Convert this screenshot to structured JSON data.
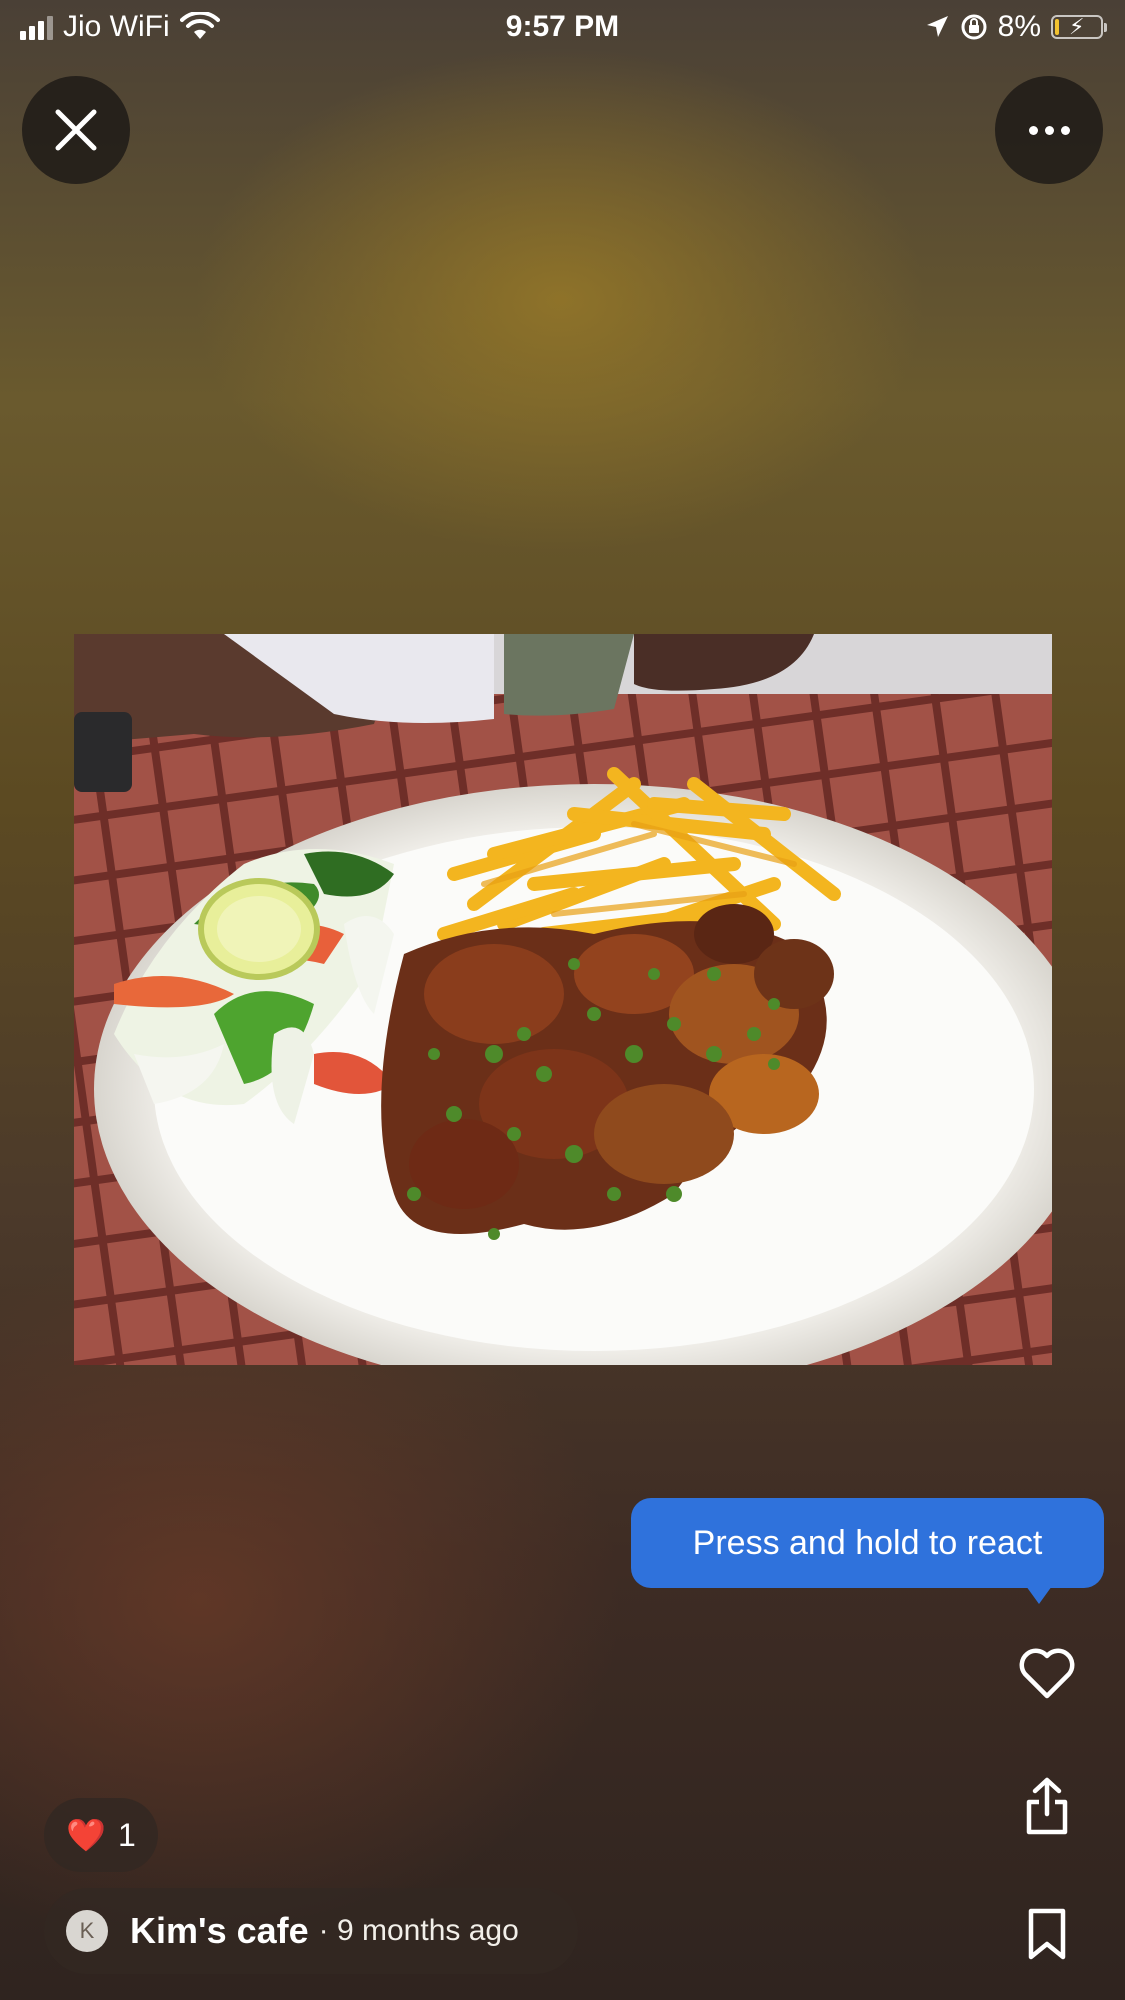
{
  "status_bar": {
    "carrier": "Jio WiFi",
    "time": "9:57 PM",
    "battery_percent": "8%",
    "battery_level": 0.08,
    "icons": [
      "signal-bars-icon",
      "wifi-icon",
      "location-arrow-icon",
      "rotation-lock-icon",
      "battery-charging-icon"
    ]
  },
  "header": {
    "close_icon": "close-icon",
    "more_icon": "more-horizontal-icon"
  },
  "photo": {
    "subject": "plate of grilled chicken, fries, salad and lime"
  },
  "tooltip": {
    "text": "Press and hold to react",
    "color": "#2f72dc"
  },
  "actions": {
    "react_icon": "heart-outline-icon",
    "share_icon": "share-icon",
    "save_icon": "bookmark-icon"
  },
  "reactions": {
    "emoji": "❤️",
    "count": "1"
  },
  "author": {
    "initial": "K",
    "name": "Kim's cafe",
    "meta": "· 9 months ago"
  }
}
